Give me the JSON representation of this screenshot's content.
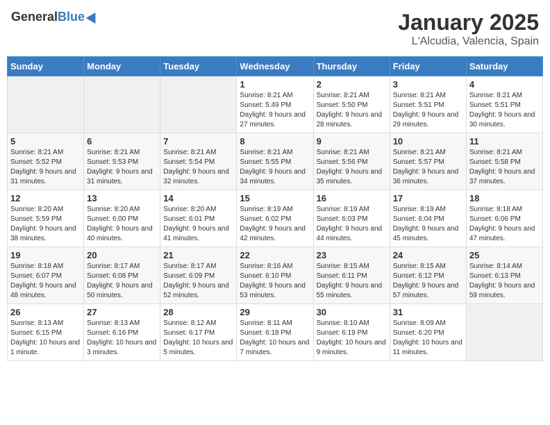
{
  "logo": {
    "text_general": "General",
    "text_blue": "Blue"
  },
  "header": {
    "month": "January 2025",
    "location": "L'Alcudia, Valencia, Spain"
  },
  "weekdays": [
    "Sunday",
    "Monday",
    "Tuesday",
    "Wednesday",
    "Thursday",
    "Friday",
    "Saturday"
  ],
  "weeks": [
    [
      {
        "day": "",
        "sunrise": "",
        "sunset": "",
        "daylight": ""
      },
      {
        "day": "",
        "sunrise": "",
        "sunset": "",
        "daylight": ""
      },
      {
        "day": "",
        "sunrise": "",
        "sunset": "",
        "daylight": ""
      },
      {
        "day": "1",
        "sunrise": "Sunrise: 8:21 AM",
        "sunset": "Sunset: 5:49 PM",
        "daylight": "Daylight: 9 hours and 27 minutes."
      },
      {
        "day": "2",
        "sunrise": "Sunrise: 8:21 AM",
        "sunset": "Sunset: 5:50 PM",
        "daylight": "Daylight: 9 hours and 28 minutes."
      },
      {
        "day": "3",
        "sunrise": "Sunrise: 8:21 AM",
        "sunset": "Sunset: 5:51 PM",
        "daylight": "Daylight: 9 hours and 29 minutes."
      },
      {
        "day": "4",
        "sunrise": "Sunrise: 8:21 AM",
        "sunset": "Sunset: 5:51 PM",
        "daylight": "Daylight: 9 hours and 30 minutes."
      }
    ],
    [
      {
        "day": "5",
        "sunrise": "Sunrise: 8:21 AM",
        "sunset": "Sunset: 5:52 PM",
        "daylight": "Daylight: 9 hours and 31 minutes."
      },
      {
        "day": "6",
        "sunrise": "Sunrise: 8:21 AM",
        "sunset": "Sunset: 5:53 PM",
        "daylight": "Daylight: 9 hours and 31 minutes."
      },
      {
        "day": "7",
        "sunrise": "Sunrise: 8:21 AM",
        "sunset": "Sunset: 5:54 PM",
        "daylight": "Daylight: 9 hours and 32 minutes."
      },
      {
        "day": "8",
        "sunrise": "Sunrise: 8:21 AM",
        "sunset": "Sunset: 5:55 PM",
        "daylight": "Daylight: 9 hours and 34 minutes."
      },
      {
        "day": "9",
        "sunrise": "Sunrise: 8:21 AM",
        "sunset": "Sunset: 5:56 PM",
        "daylight": "Daylight: 9 hours and 35 minutes."
      },
      {
        "day": "10",
        "sunrise": "Sunrise: 8:21 AM",
        "sunset": "Sunset: 5:57 PM",
        "daylight": "Daylight: 9 hours and 36 minutes."
      },
      {
        "day": "11",
        "sunrise": "Sunrise: 8:21 AM",
        "sunset": "Sunset: 5:58 PM",
        "daylight": "Daylight: 9 hours and 37 minutes."
      }
    ],
    [
      {
        "day": "12",
        "sunrise": "Sunrise: 8:20 AM",
        "sunset": "Sunset: 5:59 PM",
        "daylight": "Daylight: 9 hours and 38 minutes."
      },
      {
        "day": "13",
        "sunrise": "Sunrise: 8:20 AM",
        "sunset": "Sunset: 6:00 PM",
        "daylight": "Daylight: 9 hours and 40 minutes."
      },
      {
        "day": "14",
        "sunrise": "Sunrise: 8:20 AM",
        "sunset": "Sunset: 6:01 PM",
        "daylight": "Daylight: 9 hours and 41 minutes."
      },
      {
        "day": "15",
        "sunrise": "Sunrise: 8:19 AM",
        "sunset": "Sunset: 6:02 PM",
        "daylight": "Daylight: 9 hours and 42 minutes."
      },
      {
        "day": "16",
        "sunrise": "Sunrise: 8:19 AM",
        "sunset": "Sunset: 6:03 PM",
        "daylight": "Daylight: 9 hours and 44 minutes."
      },
      {
        "day": "17",
        "sunrise": "Sunrise: 8:19 AM",
        "sunset": "Sunset: 6:04 PM",
        "daylight": "Daylight: 9 hours and 45 minutes."
      },
      {
        "day": "18",
        "sunrise": "Sunrise: 8:18 AM",
        "sunset": "Sunset: 6:06 PM",
        "daylight": "Daylight: 9 hours and 47 minutes."
      }
    ],
    [
      {
        "day": "19",
        "sunrise": "Sunrise: 8:18 AM",
        "sunset": "Sunset: 6:07 PM",
        "daylight": "Daylight: 9 hours and 48 minutes."
      },
      {
        "day": "20",
        "sunrise": "Sunrise: 8:17 AM",
        "sunset": "Sunset: 6:08 PM",
        "daylight": "Daylight: 9 hours and 50 minutes."
      },
      {
        "day": "21",
        "sunrise": "Sunrise: 8:17 AM",
        "sunset": "Sunset: 6:09 PM",
        "daylight": "Daylight: 9 hours and 52 minutes."
      },
      {
        "day": "22",
        "sunrise": "Sunrise: 8:16 AM",
        "sunset": "Sunset: 6:10 PM",
        "daylight": "Daylight: 9 hours and 53 minutes."
      },
      {
        "day": "23",
        "sunrise": "Sunrise: 8:15 AM",
        "sunset": "Sunset: 6:11 PM",
        "daylight": "Daylight: 9 hours and 55 minutes."
      },
      {
        "day": "24",
        "sunrise": "Sunrise: 8:15 AM",
        "sunset": "Sunset: 6:12 PM",
        "daylight": "Daylight: 9 hours and 57 minutes."
      },
      {
        "day": "25",
        "sunrise": "Sunrise: 8:14 AM",
        "sunset": "Sunset: 6:13 PM",
        "daylight": "Daylight: 9 hours and 59 minutes."
      }
    ],
    [
      {
        "day": "26",
        "sunrise": "Sunrise: 8:13 AM",
        "sunset": "Sunset: 6:15 PM",
        "daylight": "Daylight: 10 hours and 1 minute."
      },
      {
        "day": "27",
        "sunrise": "Sunrise: 8:13 AM",
        "sunset": "Sunset: 6:16 PM",
        "daylight": "Daylight: 10 hours and 3 minutes."
      },
      {
        "day": "28",
        "sunrise": "Sunrise: 8:12 AM",
        "sunset": "Sunset: 6:17 PM",
        "daylight": "Daylight: 10 hours and 5 minutes."
      },
      {
        "day": "29",
        "sunrise": "Sunrise: 8:11 AM",
        "sunset": "Sunset: 6:18 PM",
        "daylight": "Daylight: 10 hours and 7 minutes."
      },
      {
        "day": "30",
        "sunrise": "Sunrise: 8:10 AM",
        "sunset": "Sunset: 6:19 PM",
        "daylight": "Daylight: 10 hours and 9 minutes."
      },
      {
        "day": "31",
        "sunrise": "Sunrise: 8:09 AM",
        "sunset": "Sunset: 6:20 PM",
        "daylight": "Daylight: 10 hours and 11 minutes."
      },
      {
        "day": "",
        "sunrise": "",
        "sunset": "",
        "daylight": ""
      }
    ]
  ]
}
